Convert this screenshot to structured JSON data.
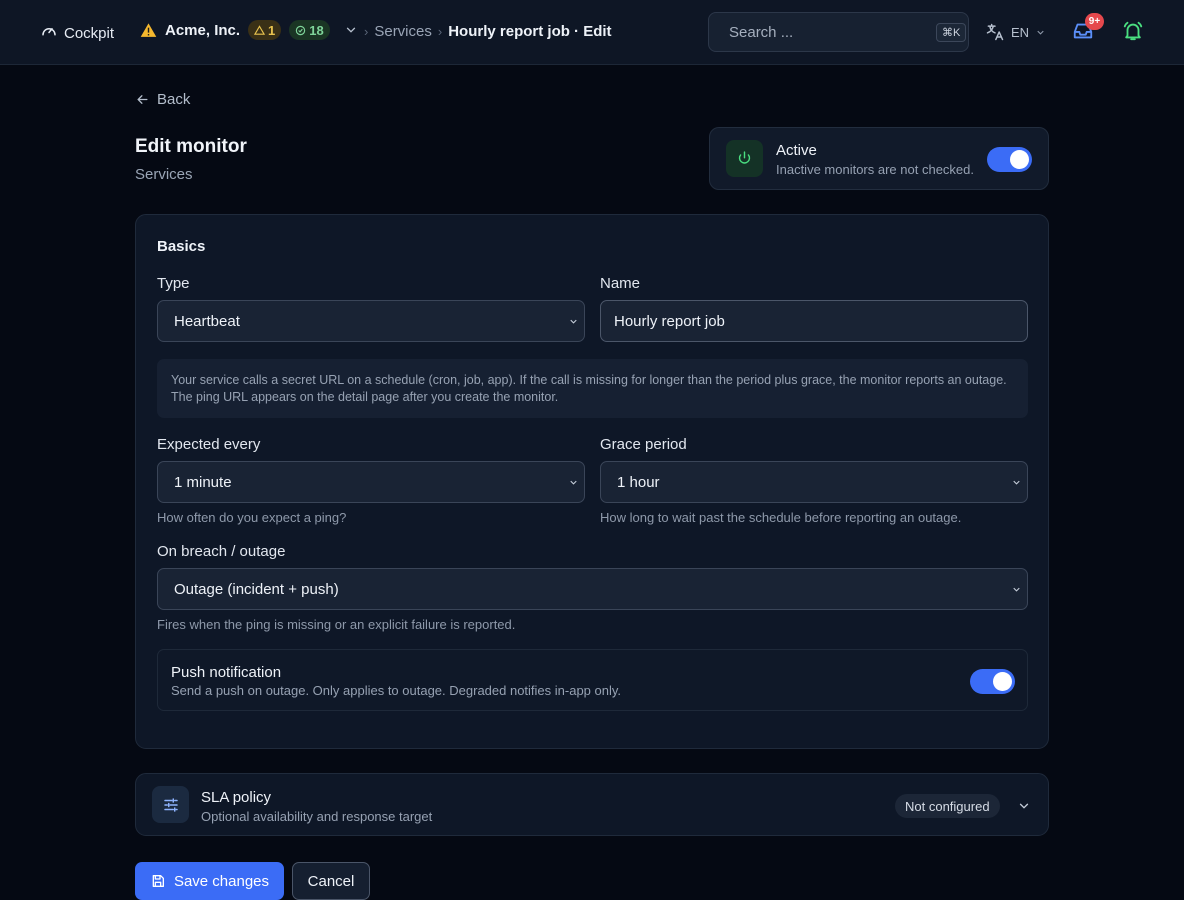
{
  "topbar": {
    "brand": "Cockpit",
    "org": {
      "name": "Acme, Inc.",
      "warning_count": "1",
      "ok_count": "18"
    },
    "breadcrumb": {
      "parent": "Services",
      "current": "Hourly report job · Edit"
    },
    "search": {
      "placeholder": "Search ...",
      "shortcut": "⌘K"
    },
    "language": "EN",
    "inbox_badge": "9+"
  },
  "back_label": "Back",
  "header": {
    "title": "Edit monitor",
    "subtitle": "Services"
  },
  "active_card": {
    "title": "Active",
    "description": "Inactive monitors are not checked.",
    "enabled": true
  },
  "basics": {
    "title": "Basics",
    "type_label": "Type",
    "type_value": "Heartbeat",
    "name_label": "Name",
    "name_value": "Hourly report job",
    "info_text": "Your service calls a secret URL on a schedule (cron, job, app). If the call is missing for longer than the period plus grace, the monitor reports an outage. The ping URL appears on the detail page after you create the monitor.",
    "expected_label": "Expected every",
    "expected_value": "1 minute",
    "expected_hint": "How often do you expect a ping?",
    "grace_label": "Grace period",
    "grace_value": "1 hour",
    "grace_hint": "How long to wait past the schedule before reporting an outage.",
    "breach_label": "On breach / outage",
    "breach_value": "Outage (incident + push)",
    "breach_hint": "Fires when the ping is missing or an explicit failure is reported.",
    "push": {
      "title": "Push notification",
      "description": "Send a push on outage. Only applies to outage. Degraded notifies in-app only.",
      "enabled": true
    }
  },
  "sla": {
    "title": "SLA policy",
    "description": "Optional availability and response target",
    "status": "Not configured"
  },
  "actions": {
    "save": "Save changes",
    "cancel": "Cancel"
  },
  "colors": {
    "accent": "#3b6cf6",
    "warning": "#e9c34f",
    "success": "#4ade80",
    "danger": "#e5484d"
  }
}
